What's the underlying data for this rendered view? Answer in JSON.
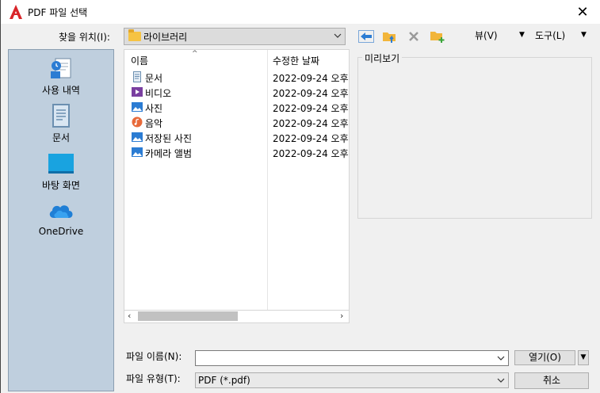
{
  "window": {
    "title": "PDF 파일 선택",
    "close_symbol": "✕"
  },
  "lookin": {
    "label": "찾을 위치(I):",
    "value": "라이브러리"
  },
  "toolbar": {
    "icons": [
      "back-arrow-icon",
      "up-folder-icon",
      "delete-icon",
      "new-folder-icon"
    ],
    "view_label": "뷰(V)",
    "tools_label": "도구(L)",
    "menu_arrow": "▼"
  },
  "places": [
    {
      "label": "사용 내역",
      "icon": "history-icon"
    },
    {
      "label": "문서",
      "icon": "documents-icon"
    },
    {
      "label": "바탕 화면",
      "icon": "desktop-icon"
    },
    {
      "label": "OneDrive",
      "icon": "onedrive-icon"
    }
  ],
  "filelist": {
    "columns": {
      "name": "이름",
      "date": "수정한 날짜"
    },
    "sort_indicator": "^",
    "rows": [
      {
        "name": "문서",
        "date": "2022-09-24 오후",
        "icon": "documents-icon"
      },
      {
        "name": "비디오",
        "date": "2022-09-24 오후",
        "icon": "video-icon"
      },
      {
        "name": "사진",
        "date": "2022-09-24 오후",
        "icon": "pictures-icon"
      },
      {
        "name": "음악",
        "date": "2022-09-24 오후",
        "icon": "music-icon"
      },
      {
        "name": "저장된 사진",
        "date": "2022-09-24 오후",
        "icon": "pictures-icon"
      },
      {
        "name": "카메라 앨범",
        "date": "2022-09-24 오후",
        "icon": "pictures-icon"
      }
    ],
    "scroll_left": "‹",
    "scroll_right": "›"
  },
  "preview": {
    "label": "미리보기"
  },
  "filename": {
    "label": "파일 이름(N):",
    "value": ""
  },
  "filetype": {
    "label": "파일 유형(T):",
    "value": "PDF (*.pdf)"
  },
  "buttons": {
    "open": "열기(O)",
    "open_dropdown": "▼",
    "cancel": "취소"
  },
  "colors": {
    "places_bg": "#bfcfde",
    "accent": "#2b7cd3",
    "app_red": "#d9252a"
  }
}
